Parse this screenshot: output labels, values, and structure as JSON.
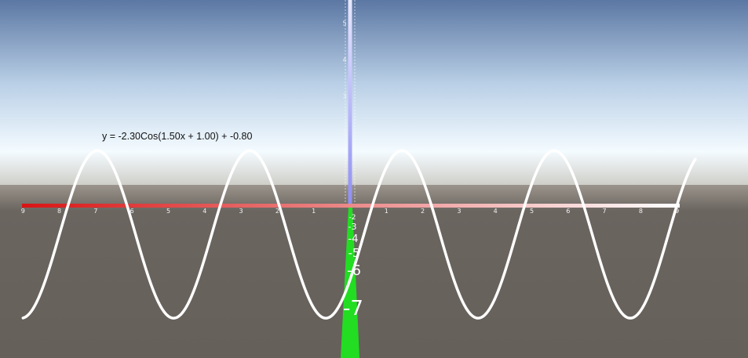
{
  "equation": "y = -2.30Cos(1.50x + 1.00) + -0.80",
  "colors": {
    "sky_top": "#5b77a3",
    "horizon": "#f4fbff",
    "ground": "#6b6560",
    "curve": "#ffffff",
    "x_axis_start": "#d91414",
    "x_axis_end": "#ffffff",
    "y_axis": "#8e8ef2",
    "z_axis": "#22dd22"
  },
  "x_axis": {
    "ticks_negative": [
      "9",
      "8",
      "7",
      "6",
      "5",
      "4",
      "3",
      "2",
      "1"
    ],
    "ticks_positive": [
      "1",
      "2",
      "3",
      "4",
      "5",
      "6",
      "7",
      "8",
      "9"
    ]
  },
  "y_axis": {
    "ticks": [
      "5",
      "4",
      "3",
      "2"
    ]
  },
  "z_axis": {
    "labels": [
      "-1",
      "-2",
      "-3",
      "-4",
      "-5",
      "-6",
      "-7"
    ]
  },
  "chart_data": {
    "type": "line",
    "title": "y = -2.30Cos(1.50x + 1.00) + -0.80",
    "function": {
      "amplitude": -2.3,
      "frequency": 1.5,
      "phase": 1.0,
      "offset": -0.8
    },
    "xlim": [
      -9,
      9.5
    ],
    "ylim": [
      -4,
      5.5
    ]
  }
}
